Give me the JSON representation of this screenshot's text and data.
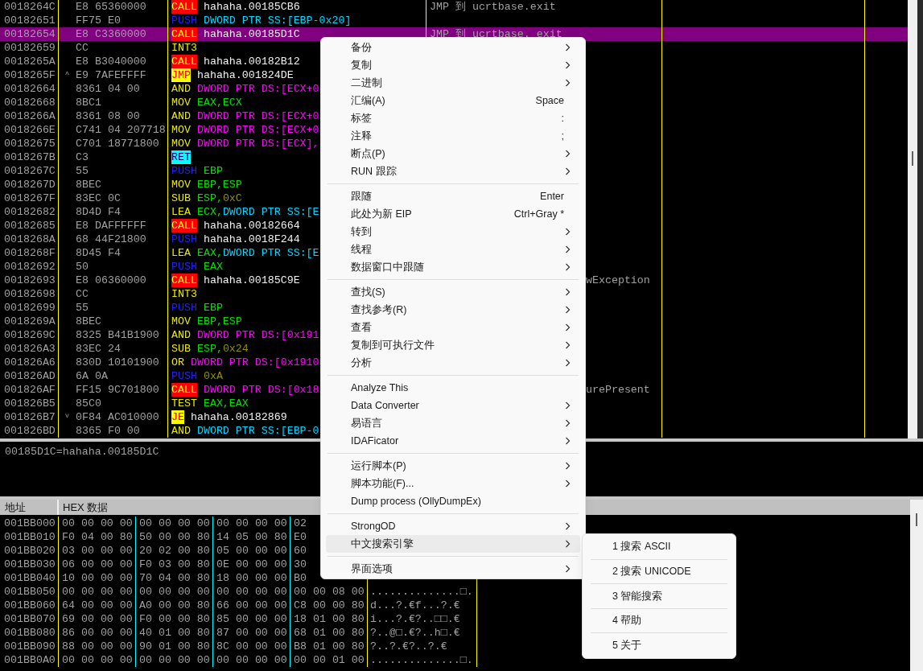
{
  "disassembly": {
    "rows": [
      {
        "address": "0018264C",
        "hex": "E8 65360000",
        "mnemonic": {
          "text": "CALL",
          "kind": "call"
        },
        "operands": [
          {
            "text": "hahaha.00185CB6",
            "kind": "label"
          }
        ],
        "comment": {
          "text": "JMP 到 ucrtbase.exit",
          "partial": false
        },
        "selected": false
      },
      {
        "address": "00182651",
        "hex": "FF75 E0",
        "mnemonic": {
          "text": "PUSH",
          "kind": "push"
        },
        "operands": [
          {
            "text": "DWORD PTR SS:[EBP-0x20]",
            "kind": "stack"
          }
        ],
        "selected": false
      },
      {
        "address": "00182654",
        "hex": "E8 C3360000",
        "mnemonic": {
          "text": "CALL",
          "kind": "call"
        },
        "operands": [
          {
            "text": "hahaha.00185D1C",
            "kind": "label"
          }
        ],
        "comment": {
          "text": "JMP 到 ucrtbase._exit",
          "partial": false
        },
        "selected": true
      },
      {
        "address": "00182659",
        "hex": "CC",
        "mnemonic": {
          "text": "INT3",
          "kind": "plain"
        },
        "selected": false
      },
      {
        "address": "0018265A",
        "hex": "E8 B3040000",
        "mnemonic": {
          "text": "CALL",
          "kind": "call"
        },
        "operands": [
          {
            "text": "hahaha.00182B12",
            "kind": "label"
          }
        ],
        "selected": false
      },
      {
        "address": "0018265F",
        "jump_mark": "^",
        "hex": "E9 7AFEFFFF",
        "mnemonic": {
          "text": "JMP",
          "kind": "jump"
        },
        "operands": [
          {
            "text": "hahaha.001824DE",
            "kind": "label"
          }
        ],
        "selected": false
      },
      {
        "address": "00182664",
        "hex": "8361 04 00",
        "mnemonic": {
          "text": "AND",
          "kind": "plain"
        },
        "operands": [
          {
            "text": "DWORD PTR DS:[ECX+0",
            "kind": "mem"
          }
        ],
        "selected": false
      },
      {
        "address": "00182668",
        "hex": "8BC1",
        "mnemonic": {
          "text": "MOV",
          "kind": "plain"
        },
        "operands": [
          {
            "text": "EAX,ECX",
            "kind": "reg"
          }
        ],
        "selected": false
      },
      {
        "address": "0018266A",
        "hex": "8361 08 00",
        "mnemonic": {
          "text": "AND",
          "kind": "plain"
        },
        "operands": [
          {
            "text": "DWORD PTR DS:[ECX+0",
            "kind": "mem"
          }
        ],
        "selected": false
      },
      {
        "address": "0018266E",
        "hex": "C741 04 207718",
        "mnemonic": {
          "text": "MOV",
          "kind": "plain"
        },
        "operands": [
          {
            "text": "DWORD PTR DS:[ECX+0",
            "kind": "mem"
          }
        ],
        "selected": false
      },
      {
        "address": "00182675",
        "hex": "C701 18771800",
        "mnemonic": {
          "text": "MOV",
          "kind": "plain"
        },
        "operands": [
          {
            "text": "DWORD PTR DS:[ECX],",
            "kind": "mem"
          }
        ],
        "selected": false
      },
      {
        "address": "0018267B",
        "hex": "C3",
        "mnemonic": {
          "text": "RET",
          "kind": "ret"
        },
        "selected": false
      },
      {
        "address": "0018267C",
        "hex": "55",
        "mnemonic": {
          "text": "PUSH",
          "kind": "push"
        },
        "operands": [
          {
            "text": "EBP",
            "kind": "reg"
          }
        ],
        "selected": false
      },
      {
        "address": "0018267D",
        "hex": "8BEC",
        "mnemonic": {
          "text": "MOV",
          "kind": "plain"
        },
        "operands": [
          {
            "text": "EBP,ESP",
            "kind": "reg"
          }
        ],
        "selected": false
      },
      {
        "address": "0018267F",
        "hex": "83EC 0C",
        "mnemonic": {
          "text": "SUB",
          "kind": "plain"
        },
        "operands": [
          {
            "text": "ESP,",
            "kind": "reg"
          },
          {
            "text": "0xC",
            "kind": "const"
          }
        ],
        "selected": false
      },
      {
        "address": "00182682",
        "hex": "8D4D F4",
        "mnemonic": {
          "text": "LEA",
          "kind": "plain"
        },
        "operands": [
          {
            "text": "ECX,",
            "kind": "reg"
          },
          {
            "text": "DWORD PTR SS:[E",
            "kind": "stack"
          }
        ],
        "selected": false
      },
      {
        "address": "00182685",
        "hex": "E8 DAFFFFFF",
        "mnemonic": {
          "text": "CALL",
          "kind": "call"
        },
        "operands": [
          {
            "text": "hahaha.00182664",
            "kind": "label"
          }
        ],
        "selected": false
      },
      {
        "address": "0018268A",
        "hex": "68 44F21800",
        "mnemonic": {
          "text": "PUSH",
          "kind": "push"
        },
        "operands": [
          {
            "text": "hahaha.0018F244",
            "kind": "label"
          }
        ],
        "selected": false
      },
      {
        "address": "0018268F",
        "hex": "8D45 F4",
        "mnemonic": {
          "text": "LEA",
          "kind": "plain"
        },
        "operands": [
          {
            "text": "EAX,",
            "kind": "reg"
          },
          {
            "text": "DWORD PTR SS:[E",
            "kind": "stack"
          }
        ],
        "selected": false
      },
      {
        "address": "00182692",
        "hex": "50",
        "mnemonic": {
          "text": "PUSH",
          "kind": "push"
        },
        "operands": [
          {
            "text": "EAX",
            "kind": "reg"
          }
        ],
        "selected": false
      },
      {
        "address": "00182693",
        "hex": "E8 06360000",
        "mnemonic": {
          "text": "CALL",
          "kind": "call"
        },
        "operands": [
          {
            "text": "hahaha.00185C9E",
            "kind": "label"
          }
        ],
        "comment": {
          "text": "wException",
          "partial": true
        },
        "selected": false
      },
      {
        "address": "00182698",
        "hex": "CC",
        "mnemonic": {
          "text": "INT3",
          "kind": "plain"
        },
        "selected": false
      },
      {
        "address": "00182699",
        "hex": "55",
        "mnemonic": {
          "text": "PUSH",
          "kind": "push"
        },
        "operands": [
          {
            "text": "EBP",
            "kind": "reg"
          }
        ],
        "selected": false
      },
      {
        "address": "0018269A",
        "hex": "8BEC",
        "mnemonic": {
          "text": "MOV",
          "kind": "plain"
        },
        "operands": [
          {
            "text": "EBP,ESP",
            "kind": "reg"
          }
        ],
        "selected": false
      },
      {
        "address": "0018269C",
        "hex": "8325 B41B1900",
        "mnemonic": {
          "text": "AND",
          "kind": "plain"
        },
        "operands": [
          {
            "text": "DWORD PTR DS:[0x191",
            "kind": "mem"
          }
        ],
        "selected": false
      },
      {
        "address": "001826A3",
        "hex": "83EC 24",
        "mnemonic": {
          "text": "SUB",
          "kind": "plain"
        },
        "operands": [
          {
            "text": "ESP,",
            "kind": "reg"
          },
          {
            "text": "0x24",
            "kind": "const"
          }
        ],
        "selected": false
      },
      {
        "address": "001826A6",
        "hex": "830D 10101900",
        "mnemonic": {
          "text": "OR",
          "kind": "plain"
        },
        "operands": [
          {
            "text": "DWORD PTR DS:[0x1910",
            "kind": "mem"
          }
        ],
        "selected": false
      },
      {
        "address": "001826AD",
        "hex": "6A 0A",
        "mnemonic": {
          "text": "PUSH",
          "kind": "push"
        },
        "operands": [
          {
            "text": "0xA",
            "kind": "const"
          }
        ],
        "selected": false
      },
      {
        "address": "001826AF",
        "hex": "FF15 9C701800",
        "mnemonic": {
          "text": "CALL",
          "kind": "call"
        },
        "operands": [
          {
            "text": "DWORD PTR DS:[0x18",
            "kind": "mem"
          }
        ],
        "comment": {
          "text": "urePresent",
          "partial": true
        },
        "selected": false
      },
      {
        "address": "001826B5",
        "hex": "85C0",
        "mnemonic": {
          "text": "TEST",
          "kind": "plain"
        },
        "operands": [
          {
            "text": "EAX,EAX",
            "kind": "reg"
          }
        ],
        "selected": false
      },
      {
        "address": "001826B7",
        "jump_mark": "˅",
        "hex": "0F84 AC010000",
        "mnemonic": {
          "text": "JE",
          "kind": "jump"
        },
        "operands": [
          {
            "text": "hahaha.00182869",
            "kind": "label"
          }
        ],
        "selected": false
      },
      {
        "address": "001826BD",
        "hex": "8365 F0 00",
        "mnemonic": {
          "text": "AND",
          "kind": "plain"
        },
        "operands": [
          {
            "text": "DWORD PTR SS:[EBP-0",
            "kind": "stack"
          }
        ],
        "selected": false
      }
    ]
  },
  "info_pane": {
    "text": "00185D1C=hahaha.00185D1C"
  },
  "dump": {
    "columns": [
      "地址",
      "HEX 数据"
    ],
    "rows": [
      {
        "address": "001BB000",
        "groups": [
          "00 00 00 00",
          "00 00 00 00",
          "00 00 00 00",
          "02"
        ]
      },
      {
        "address": "001BB010",
        "groups": [
          "F0 04 00 80",
          "50 00 00 80",
          "14 05 00 80",
          "E0"
        ]
      },
      {
        "address": "001BB020",
        "groups": [
          "03 00 00 00",
          "20 02 00 80",
          "05 00 00 00",
          "60"
        ]
      },
      {
        "address": "001BB030",
        "groups": [
          "06 00 00 00",
          "F0 03 00 80",
          "0E 00 00 00",
          "30"
        ]
      },
      {
        "address": "001BB040",
        "groups": [
          "10 00 00 00",
          "70 04 00 80",
          "18 00 00 00",
          "B0"
        ]
      },
      {
        "address": "001BB050",
        "groups": [
          "00 00 00 00",
          "00 00 00 00",
          "00 00 00 00",
          "00 00 08 00"
        ],
        "ascii": "..............□."
      },
      {
        "address": "001BB060",
        "groups": [
          "64 00 00 00",
          "A0 00 00 80",
          "66 00 00 00",
          "C8 00 00 80"
        ],
        "ascii": "d...?.€f...?.€"
      },
      {
        "address": "001BB070",
        "groups": [
          "69 00 00 00",
          "F0 00 00 80",
          "85 00 00 00",
          "18 01 00 80"
        ],
        "ascii": "i...?.€?..□□.€"
      },
      {
        "address": "001BB080",
        "groups": [
          "86 00 00 00",
          "40 01 00 80",
          "87 00 00 00",
          "68 01 00 80"
        ],
        "ascii": "?..@□.€?..h□.€"
      },
      {
        "address": "001BB090",
        "groups": [
          "88 00 00 00",
          "90 01 00 80",
          "8C 00 00 00",
          "B8 01 00 80"
        ],
        "ascii": "?..?.€?..?.€"
      },
      {
        "address": "001BB0A0",
        "groups": [
          "00 00 00 00",
          "00 00 00 00",
          "00 00 00 00",
          "00 00 01 00"
        ],
        "ascii": "..............□."
      }
    ]
  },
  "context_menu": {
    "groups": [
      [
        {
          "label": "备份",
          "has_submenu": true,
          "selected": false
        },
        {
          "label": "复制",
          "has_submenu": true,
          "selected": false
        },
        {
          "label": "二进制",
          "has_submenu": true,
          "selected": false
        },
        {
          "label": "汇编(A)",
          "shortcut": "Space",
          "has_submenu": false,
          "selected": false
        },
        {
          "label": "标签",
          "shortcut": ":",
          "has_submenu": false,
          "selected": false
        },
        {
          "label": "注释",
          "shortcut": ";",
          "has_submenu": false,
          "selected": false
        },
        {
          "label": "断点(P)",
          "has_submenu": true,
          "selected": false
        },
        {
          "label": "RUN 跟踪",
          "has_submenu": true,
          "selected": false
        }
      ],
      [
        {
          "label": "跟随",
          "shortcut": "Enter",
          "has_submenu": false,
          "selected": false
        },
        {
          "label": "此处为新 EIP",
          "shortcut": "Ctrl+Gray *",
          "has_submenu": false,
          "selected": false
        },
        {
          "label": "转到",
          "has_submenu": true,
          "selected": false
        },
        {
          "label": "线程",
          "has_submenu": true,
          "selected": false
        },
        {
          "label": "数据窗口中跟随",
          "has_submenu": true,
          "selected": false
        }
      ],
      [
        {
          "label": "查找(S)",
          "has_submenu": true,
          "selected": false
        },
        {
          "label": "查找参考(R)",
          "has_submenu": true,
          "selected": false
        },
        {
          "label": "查看",
          "has_submenu": true,
          "selected": false
        },
        {
          "label": "复制到可执行文件",
          "has_submenu": true,
          "selected": false
        },
        {
          "label": "分析",
          "has_submenu": true,
          "selected": false
        }
      ],
      [
        {
          "label": "Analyze This",
          "has_submenu": false,
          "selected": false
        },
        {
          "label": "Data Converter",
          "has_submenu": true,
          "selected": false
        },
        {
          "label": "易语言",
          "has_submenu": true,
          "selected": false
        },
        {
          "label": "IDAFicator",
          "has_submenu": true,
          "selected": false
        }
      ],
      [
        {
          "label": "运行脚本(P)",
          "has_submenu": true,
          "selected": false
        },
        {
          "label": "脚本功能(F)...",
          "has_submenu": true,
          "selected": false
        },
        {
          "label": "Dump process (OllyDumpEx)",
          "has_submenu": false,
          "selected": false
        }
      ],
      [
        {
          "label": "StrongOD",
          "has_submenu": true,
          "selected": false
        },
        {
          "label": "中文搜索引擎",
          "has_submenu": true,
          "selected": true
        }
      ],
      [
        {
          "label": "界面选项",
          "has_submenu": true,
          "selected": false
        }
      ]
    ]
  },
  "submenu": {
    "items": [
      "1 搜索 ASCII",
      "2 搜索 UNICODE",
      "3 智能搜索",
      "4 帮助",
      "5 关于"
    ]
  }
}
